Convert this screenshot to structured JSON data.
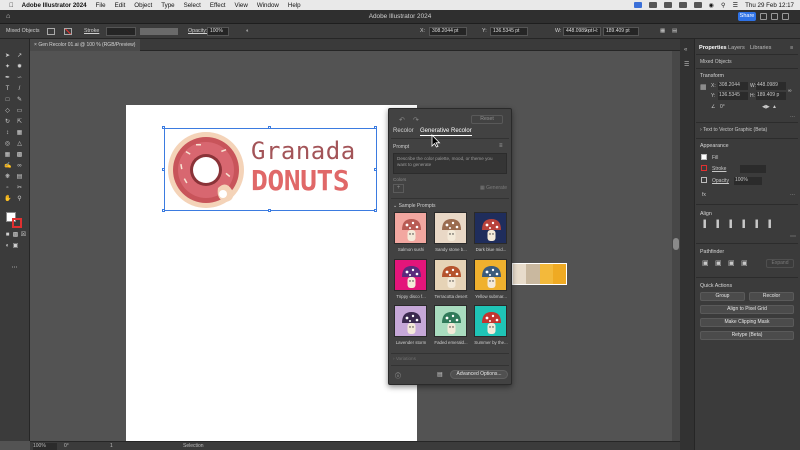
{
  "menubar": {
    "app_name": "Adobe Illustrator 2024",
    "items": [
      "File",
      "Edit",
      "Object",
      "Type",
      "Select",
      "Effect",
      "View",
      "Window",
      "Help"
    ],
    "clock": "Thu 29 Feb  12:17"
  },
  "titlebar": {
    "title": "Adobe Illustrator 2024",
    "share_label": "Share"
  },
  "controlbar": {
    "selection_label": "Mixed Objects",
    "stroke_label": "Stroke",
    "opacity_label": "Opacity:",
    "opacity_value": "100%",
    "x_value": "308.2044 pt",
    "y_value": "136.5345 pt",
    "w_value": "448.0989 pt",
    "h_value": "189.409 pt"
  },
  "document": {
    "tab_title": "Gen Recolor 01.ai @ 100 % (RGB/Preview)"
  },
  "artwork": {
    "line1": "Granada",
    "line2": "DONUTS"
  },
  "genpanel": {
    "reset_label": "Reset",
    "tab_recolor": "Recolor",
    "tab_generative": "Generative Recolor",
    "prompt_label": "Prompt",
    "prompt_placeholder": "Describe the color palette, mood, or theme you want to generate",
    "colors_label": "Colors",
    "generate_label": "Generate",
    "sample_prompts_label": "Sample Prompts",
    "samples": [
      {
        "caption": "Salmon sushi",
        "bg": "#f2a7a0",
        "cap": "#b85b54"
      },
      {
        "caption": "Sandy stone b...",
        "bg": "#e9d8c6",
        "cap": "#9a6b4f"
      },
      {
        "caption": "Dark blue mid...",
        "bg": "#1f2d5c",
        "cap": "#b8423c"
      },
      {
        "caption": "Trippy disco f...",
        "bg": "#e3157a",
        "cap": "#5a2a7c"
      },
      {
        "caption": "Terracotta desert",
        "bg": "#e6d3b6",
        "cap": "#b5532d"
      },
      {
        "caption": "Yellow submar...",
        "bg": "#f0b12e",
        "cap": "#3b5b7c"
      },
      {
        "caption": "Lavender storm",
        "bg": "#c6a8d8",
        "cap": "#3b2a4f"
      },
      {
        "caption": "Faded emerald...",
        "bg": "#a9dcbf",
        "cap": "#2f7a5a"
      },
      {
        "caption": "Summer by the...",
        "bg": "#1fc4b6",
        "cap": "#c2352f"
      }
    ],
    "variations_label": "Variations",
    "advanced_label": "Advanced Options..."
  },
  "properties": {
    "tabs": [
      "Properties",
      "Layers",
      "Libraries"
    ],
    "selection": "Mixed Objects",
    "transform_label": "Transform",
    "x": "308.2044",
    "y": "136.5345",
    "w": "448.0989",
    "h": "189.409 p",
    "angle": "0°",
    "text_to_vector": "Text to Vector Graphic (Beta)",
    "appearance_label": "Appearance",
    "fill_label": "Fill",
    "stroke_label": "Stroke",
    "opacity_label": "Opacity",
    "opacity_value": "100%",
    "align_label": "Align",
    "pathfinder_label": "Pathfinder",
    "expand_label": "Expand",
    "quick_actions_label": "Quick Actions",
    "group_label": "Group",
    "recolor_label": "Recolor",
    "align_pixel_label": "Align to Pixel Grid",
    "clipping_label": "Make Clipping Mask",
    "retype_label": "Retype (Beta)"
  },
  "status": {
    "zoom": "100%",
    "angle": "0°",
    "artboard": "1",
    "mode": "Selection"
  },
  "colors": {
    "accent": "#2e72e6",
    "donut_pink": "#c8545a",
    "donuts_text": "#e06868",
    "granada_text": "#a35458"
  }
}
